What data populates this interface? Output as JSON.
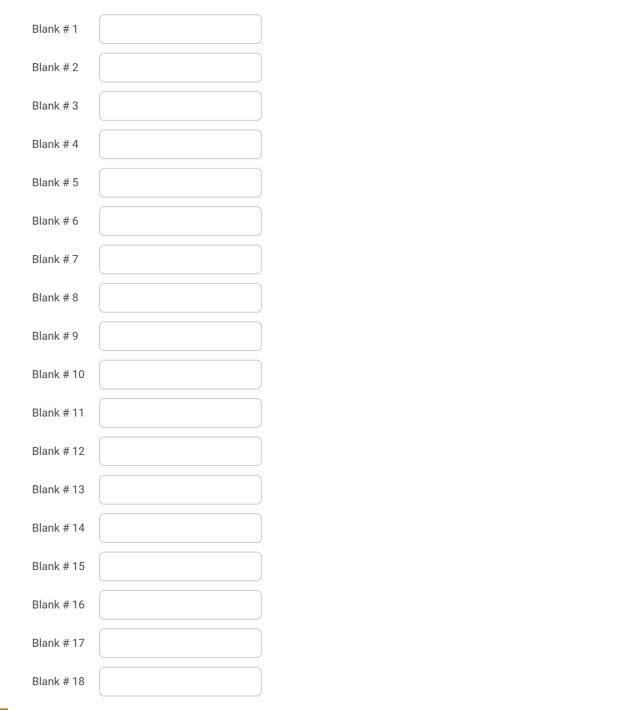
{
  "blanks": [
    {
      "label": "Blank # 1",
      "value": ""
    },
    {
      "label": "Blank # 2",
      "value": ""
    },
    {
      "label": "Blank # 3",
      "value": ""
    },
    {
      "label": "Blank # 4",
      "value": ""
    },
    {
      "label": "Blank # 5",
      "value": ""
    },
    {
      "label": "Blank # 6",
      "value": ""
    },
    {
      "label": "Blank # 7",
      "value": ""
    },
    {
      "label": "Blank # 8",
      "value": ""
    },
    {
      "label": "Blank # 9",
      "value": ""
    },
    {
      "label": "Blank # 10",
      "value": ""
    },
    {
      "label": "Blank # 11",
      "value": ""
    },
    {
      "label": "Blank # 12",
      "value": ""
    },
    {
      "label": "Blank # 13",
      "value": ""
    },
    {
      "label": "Blank # 14",
      "value": ""
    },
    {
      "label": "Blank # 15",
      "value": ""
    },
    {
      "label": "Blank # 16",
      "value": ""
    },
    {
      "label": "Blank # 17",
      "value": ""
    },
    {
      "label": "Blank # 18",
      "value": ""
    }
  ]
}
